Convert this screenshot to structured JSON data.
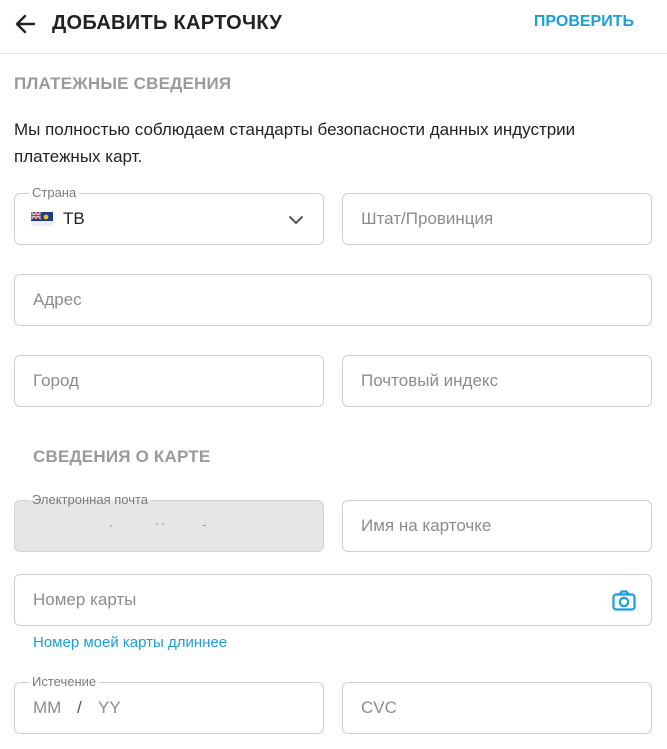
{
  "header": {
    "back_icon": "arrow-left-icon",
    "title": "ДОБАВИТЬ КАРТОЧКУ",
    "verify_label": "ПРОВЕРИТЬ"
  },
  "billing": {
    "section_title": "ПЛАТЕЖНЫЕ СВЕДЕНИЯ",
    "info_text": "Мы полностью соблюдаем стандарты безопасности данных индустрии платежных карт.",
    "country_legend": "Страна",
    "country_value": "TB",
    "country_flag_icon": "flag-icon",
    "country_chevron_icon": "chevron-down-icon",
    "state_placeholder": "Штат/Провинция",
    "address_placeholder": "Адрес",
    "city_placeholder": "Город",
    "zip_placeholder": "Почтовый индекс"
  },
  "card": {
    "section_title": "СВЕДЕНИЯ О КАРТЕ",
    "email_legend": "Электронная почта",
    "name_placeholder": "Имя на карточке",
    "number_placeholder": "Номер карты",
    "camera_icon": "camera-icon",
    "longer_card_link": "Номер моей карты длиннее",
    "expiry_legend": "Истечение",
    "expiry_month_placeholder": "MM",
    "expiry_separator": "/",
    "expiry_year_placeholder": "YY",
    "cvc_placeholder": "CVC"
  },
  "colors": {
    "accent": "#1a9fd6",
    "border": "#cfcfcf",
    "section_title": "#9a9a9a",
    "disabled_bg": "#e6e6e6"
  }
}
